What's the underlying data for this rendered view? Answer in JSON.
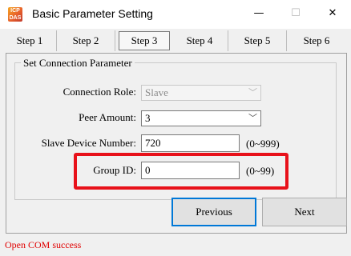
{
  "window": {
    "title": "Basic Parameter Setting",
    "icon_text": "ICP DAS",
    "minimize_glyph": "—",
    "maximize_glyph": "☐",
    "close_glyph": "✕"
  },
  "tabs": [
    {
      "label": "Step 1",
      "active": false
    },
    {
      "label": "Step 2",
      "active": false
    },
    {
      "label": "Step 3",
      "active": true
    },
    {
      "label": "Step 4",
      "active": false
    },
    {
      "label": "Step 5",
      "active": false
    },
    {
      "label": "Step 6",
      "active": false
    }
  ],
  "connection": {
    "group_title": "Set Connection Parameter",
    "role_label": "Connection Role:",
    "role_value": "Slave",
    "peer_label": "Peer Amount:",
    "peer_value": "3",
    "slave_label": "Slave Device Number:",
    "slave_value": "720",
    "slave_range": "(0~999)",
    "group_label": "Group ID:",
    "group_value": "0",
    "group_range": "(0~99)"
  },
  "buttons": {
    "previous": "Previous",
    "next": "Next"
  },
  "status": {
    "text": "Open COM success",
    "color": "#e00000"
  },
  "colors": {
    "highlight": "#e8111a",
    "focus": "#0078d7"
  }
}
